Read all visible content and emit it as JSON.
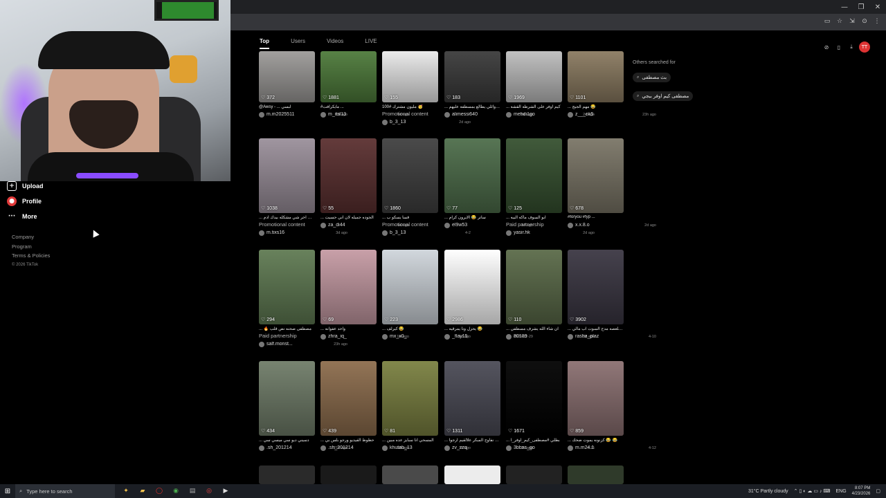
{
  "window": {
    "minimize": "—",
    "restore": "❐",
    "close": "✕"
  },
  "toolbar_icons": [
    "▭",
    "☆",
    "⇲",
    "⊙",
    "⋮"
  ],
  "nav": [
    {
      "label": "Upload",
      "icon": "+"
    },
    {
      "label": "Profile",
      "icon": "●"
    },
    {
      "label": "More",
      "icon": "···"
    }
  ],
  "footer_links": [
    "Company",
    "Program",
    "Terms & Policies"
  ],
  "copyright": "© 2026 TikTok",
  "tabs": [
    "Top",
    "Users",
    "Videos",
    "LIVE"
  ],
  "others": {
    "heading": "Others searched for",
    "items": [
      "بث مصطفى",
      "مصطفى كيم اوفر ببجي"
    ]
  },
  "top_icons": [
    "⊘",
    "▯",
    "⤓",
    "TT"
  ],
  "colors": {
    "accent": "#fe2c55",
    "bg": "#000000"
  },
  "videos": [
    {
      "likes": "372",
      "caption": "@Awsy - ... لبسي",
      "promo": "",
      "user": "m.m2025511",
      "date": "1d ago",
      "bg": "#9c9a98"
    },
    {
      "likes": "1881",
      "caption": "#مايكرافت ... ",
      "promo": "",
      "user": "m_itsl13",
      "date": "1d ago",
      "bg": "#4d7a3a"
    },
    {
      "likes": "155",
      "caption": "100# مليون مشترك 🥳",
      "promo": "Promotional content",
      "user": "b_3_13",
      "date": "2d ago",
      "bg": "#e9e9e9"
    },
    {
      "likes": "183",
      "caption": "... يحيى وائلي يطالع بمسطفه عليهم",
      "promo": "",
      "user": "alimessi640",
      "date": "1w ago",
      "bg": "#3a3a3a"
    },
    {
      "likes": "1969",
      "caption": "... كيم اوفر على الشرطه القشه",
      "promo": "",
      "user": "mehdi1go",
      "date": "2d ago",
      "bg": "#bdbdbd"
    },
    {
      "likes": "1101",
      "caption": "... مهم الجيج 😂",
      "promo": "",
      "user": "z___ok5",
      "date": "23h ago",
      "bg": "#8a7a60"
    },
    {
      "likes": "1038",
      "caption": "... حموت اخر شي مشكله بيدك ادم",
      "promo": "Promotional content",
      "user": "m.tixs16",
      "date": "3d ago",
      "bg": "#9a8f9a"
    },
    {
      "likes": "55",
      "caption": "... الجوده جميله لان اني حسيت",
      "promo": "",
      "user": "za_di44",
      "date": "1d ago",
      "bg": "#5a2f2f"
    },
    {
      "likes": "1860",
      "caption": "... قسا يسكو ب",
      "promo": "Promotional content",
      "user": "b_3_13",
      "date": "4-2",
      "bg": "#3f3f3f"
    },
    {
      "likes": "77",
      "caption": "... ساتر 😂 الايرون كرام",
      "promo": "",
      "user": "el9w53",
      "date": "1d ago",
      "bg": "#4d6d4a"
    },
    {
      "likes": "125",
      "caption": "... ابو السوف ماكه البيه",
      "promo": "Paid partnership",
      "user": "yasir.hk",
      "date": "2d ago",
      "bg": "#35502f"
    },
    {
      "likes": "678",
      "caption": "#foryou #fyp ...",
      "promo": "",
      "user": "x.x.8.o",
      "date": "2d ago",
      "bg": "#7a7566"
    },
    {
      "likes": "294",
      "caption": "... 🔥 مصطفى صحنه نص قلب",
      "promo": "Paid partnership",
      "user": "salf.monst...",
      "date": "23h ago",
      "bg": "#5f7a52"
    },
    {
      "likes": "69",
      "caption": "... واحد عفوانه",
      "promo": "",
      "user": "zhra_iq_",
      "date": "1w ago",
      "bg": "#c59aa3"
    },
    {
      "likes": "223",
      "caption": "... كيرلف 😂",
      "promo": "",
      "user": "mx_x0_",
      "date": "1d ago",
      "bg": "#cfd5db"
    },
    {
      "likes": "2986",
      "caption": "... يحزل ونا يمرقيه 😂",
      "promo": "",
      "user": "_flay15",
      "date": "2025-12-29",
      "bg": "#ffffff"
    },
    {
      "likes": "110",
      "caption": "... ان شاء الله يشرف مسطفي",
      "promo": "",
      "user": "80189",
      "date": "2d ago",
      "bg": "#5a6a48"
    },
    {
      "likes": "3902",
      "caption": "... اوفر بلعصه مدح السوت اب مالي",
      "promo": "",
      "user": "rasha_plaz",
      "date": "4-10",
      "bg": "#3a3642"
    },
    {
      "likes": "434",
      "caption": "... دسيني ديو سي ميسي سي",
      "promo": "",
      "user": ".sh_201214",
      "date": "21h ago",
      "bg": "#6f7c68"
    },
    {
      "likes": "439",
      "caption": "... حظوظ الفيديو ورجو بلس بي",
      "promo": "",
      "user": ".sh_201214",
      "date": "2d ago",
      "bg": "#8c6c4c"
    },
    {
      "likes": "81",
      "caption": "... المسحي انا سبايز عده مبين",
      "promo": "",
      "user": "khutab_13",
      "date": "1d ago",
      "bg": "#7a8040"
    },
    {
      "likes": "1311",
      "caption": "... بطاره نفاوج المبكر علالقيم ارجوا",
      "promo": "",
      "user": "zv_zzq",
      "date": "2d ago",
      "bg": "#4a4a55"
    },
    {
      "likes": "1671",
      "caption": "... بطلي #مصطفى_كيم_اوفر_ا",
      "promo": "",
      "user": "3bbas_go",
      "date": "4-15",
      "bg": "#000000"
    },
    {
      "likes": "859",
      "caption": "... كزنونه يموت ضحك 😂 😂",
      "promo": "",
      "user": "m.m24.1",
      "date": "4-12",
      "bg": "#8a6f70"
    }
  ],
  "partial_row_colors": [
    "#2a2a2a",
    "#1a1a1a",
    "#4a4a4a",
    "#ececec",
    "#222",
    "#2f3a2a"
  ],
  "taskbar": {
    "search_placeholder": "Type here to search",
    "weather": "31°C  Partly cloudy",
    "lang": "ENG",
    "time": "8:07 PM",
    "date": "4/23/2026"
  }
}
